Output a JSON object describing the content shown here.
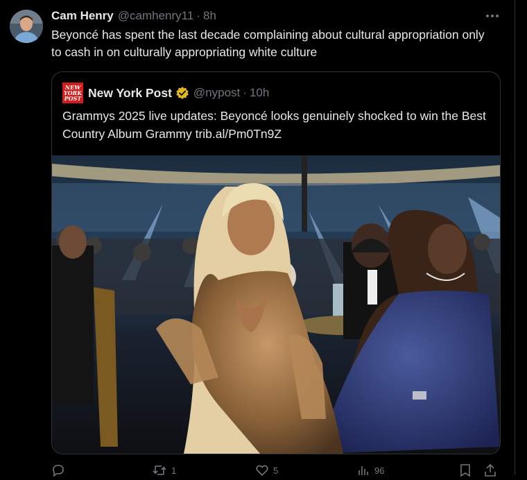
{
  "tweet": {
    "author_name": "Cam Henry",
    "author_handle": "@camhenry11",
    "separator": "·",
    "timestamp": "8h",
    "text": "Beyoncé has spent the last decade complaining about cultural appropriation only to cash in on culturally appropriating white culture"
  },
  "quote": {
    "logo_lines": [
      "NEW",
      "YORK",
      "POST"
    ],
    "author_name": "New York Post",
    "verified": true,
    "author_handle": "@nypost",
    "separator": "·",
    "timestamp": "10h",
    "text": "Grammys 2025 live updates: Beyoncé looks genuinely shocked to win the Best Country Album Grammy trib.al/Pm0Tn9Z"
  },
  "actions": {
    "reply_count": "",
    "retweet_count": "1",
    "like_count": "5",
    "views_count": "96"
  },
  "icons": {
    "more": "more-horizontal-icon",
    "reply": "reply-icon",
    "retweet": "retweet-icon",
    "like": "heart-icon",
    "views": "views-icon",
    "bookmark": "bookmark-icon",
    "share": "share-icon",
    "verified": "verified-badge-icon"
  },
  "colors": {
    "background": "#000000",
    "text": "#e7e9ea",
    "muted": "#71767b",
    "border": "#2f3336",
    "brand_red": "#d41c1c",
    "verified_gold": "#e2b719"
  }
}
